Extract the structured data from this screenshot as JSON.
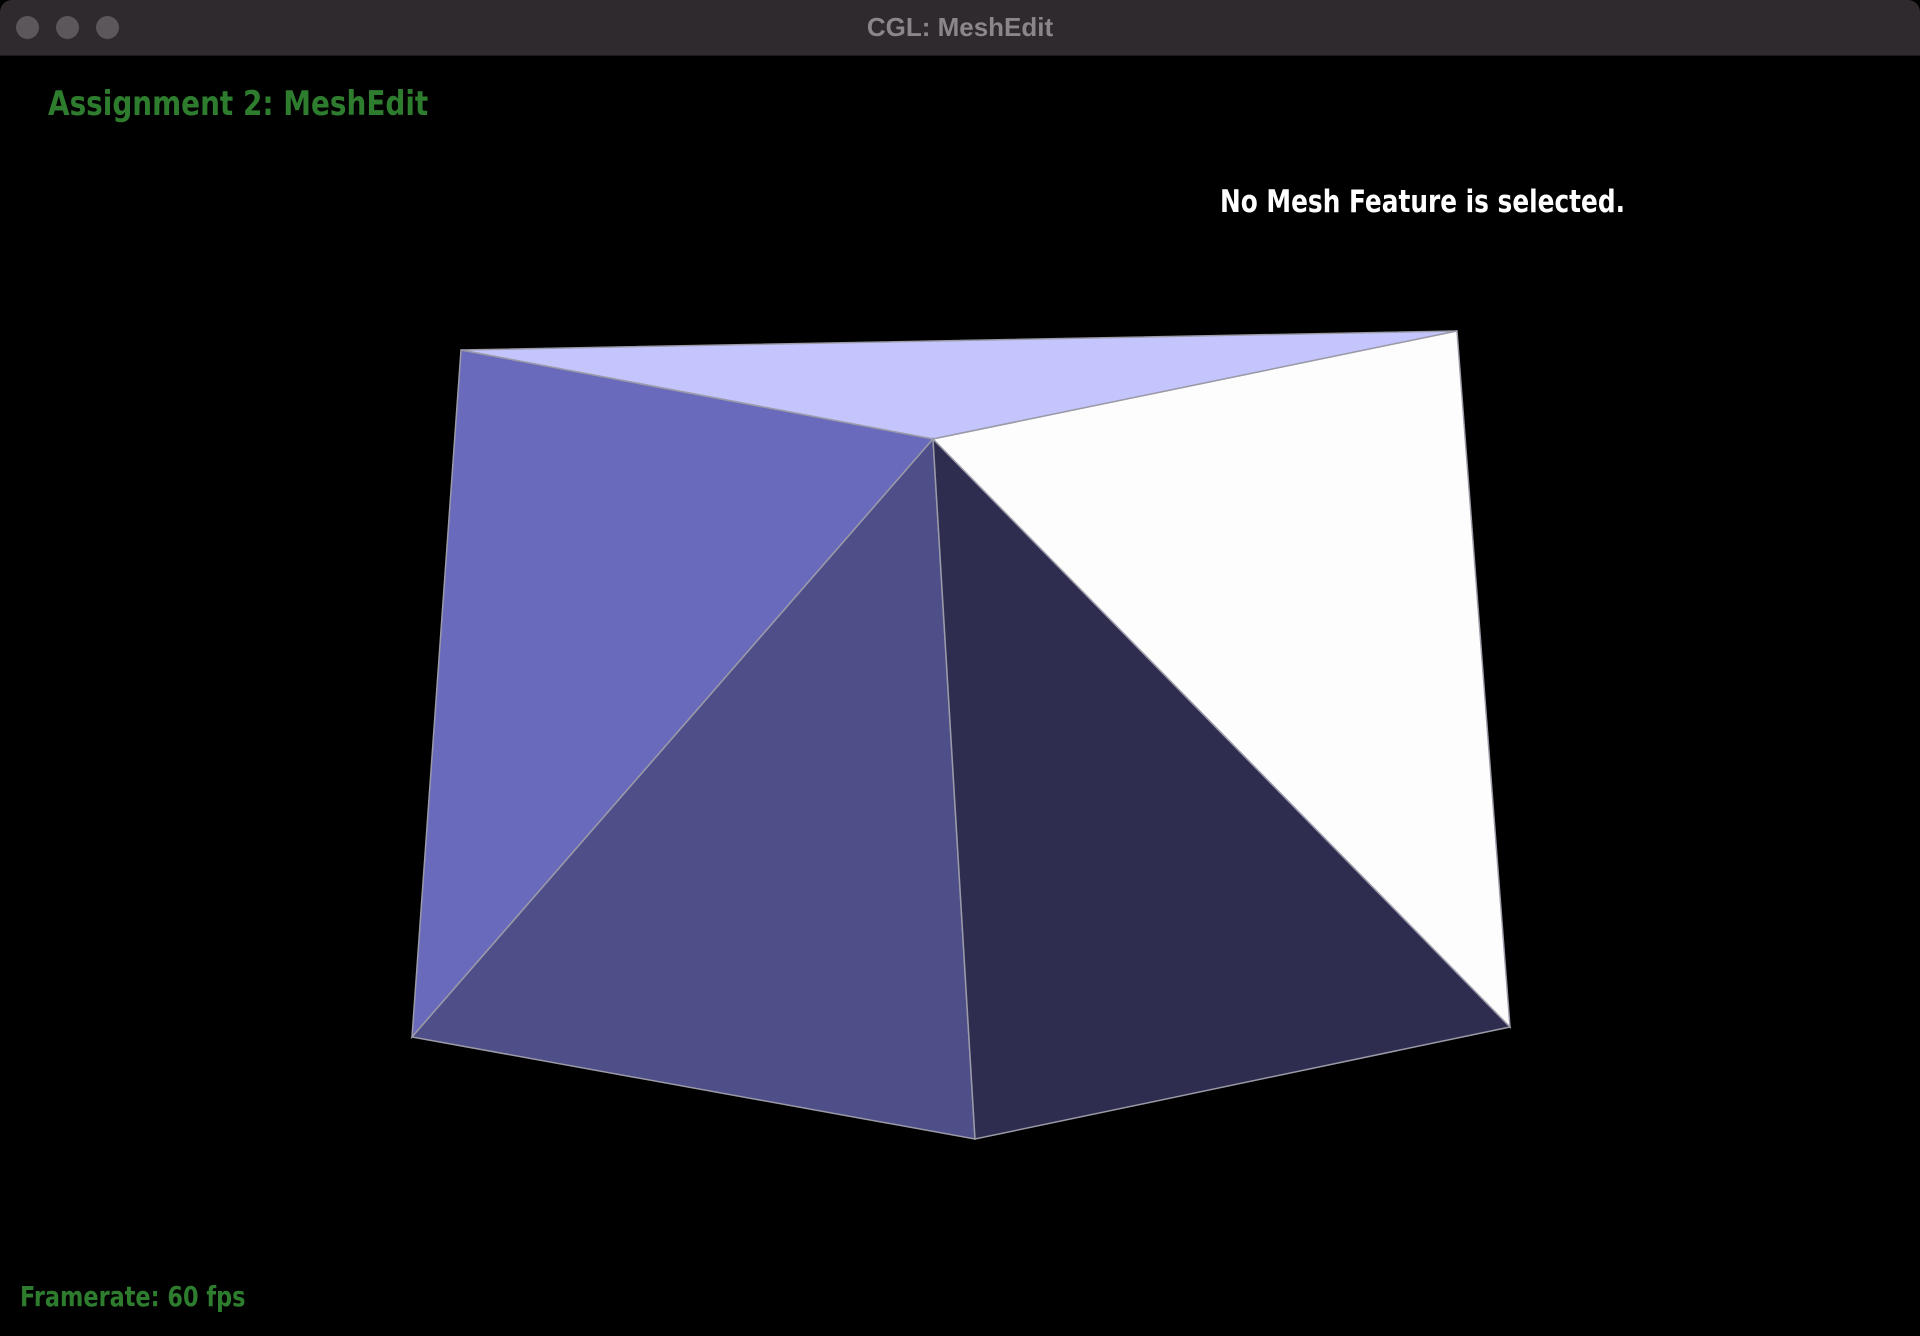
{
  "window": {
    "title": "CGL: MeshEdit"
  },
  "hud": {
    "assignment_title": "Assignment 2: MeshEdit",
    "selection_status": "No Mesh Feature is selected.",
    "framerate": "Framerate: 60 fps"
  },
  "colors": {
    "hud_green": "#2e7d2e",
    "face_top": "#c5c5fd",
    "face_left": "#6a6abc",
    "face_front_left": "#4e4e88",
    "face_front_right": "#2e2d50",
    "face_right": "#fdfdfe",
    "edge": "#9a9aa8"
  },
  "mesh": {
    "faces": [
      {
        "name": "top",
        "color_key": "face_top"
      },
      {
        "name": "left",
        "color_key": "face_left"
      },
      {
        "name": "front-left",
        "color_key": "face_front_left"
      },
      {
        "name": "front-right",
        "color_key": "face_front_right"
      },
      {
        "name": "right",
        "color_key": "face_right"
      }
    ]
  }
}
